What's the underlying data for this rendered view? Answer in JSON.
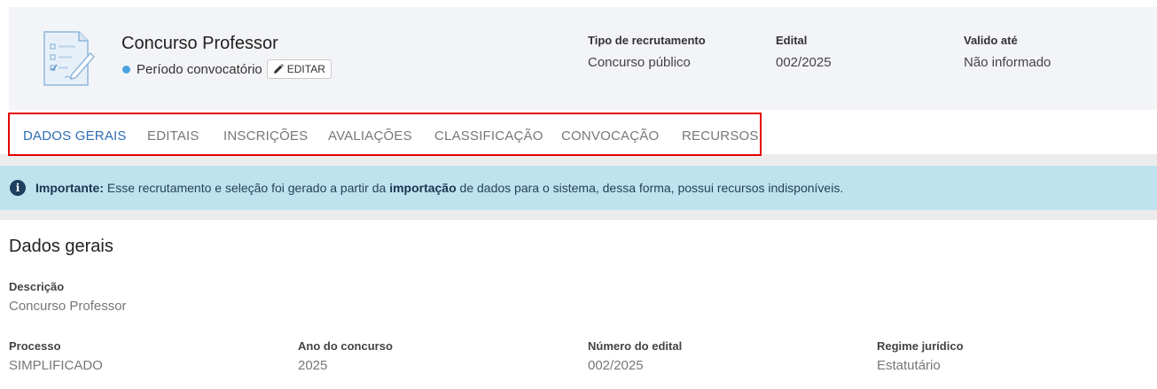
{
  "header": {
    "title": "Concurso Professor",
    "status": "Período convocatório",
    "edit_label": "EDITAR",
    "meta": [
      {
        "label": "Tipo de recrutamento",
        "value": "Concurso público"
      },
      {
        "label": "Edital",
        "value": "002/2025"
      },
      {
        "label": "Valido até",
        "value": "Não informado"
      }
    ]
  },
  "tabs": [
    {
      "label": "DADOS GERAIS",
      "active": true
    },
    {
      "label": "EDITAIS",
      "active": false
    },
    {
      "label": "INSCRIÇÕES",
      "active": false
    },
    {
      "label": "AVALIAÇÕES",
      "active": false
    },
    {
      "label": "CLASSIFICAÇÃO",
      "active": false
    },
    {
      "label": "CONVOCAÇÃO",
      "active": false
    },
    {
      "label": "RECURSOS",
      "active": false
    }
  ],
  "alert": {
    "icon": "info-icon",
    "strong_prefix": "Importante:",
    "text_before": " Esse recrutamento e seleção foi gerado a partir da ",
    "strong_word": "importação",
    "text_after": " de dados para o sistema, dessa forma, possui recursos indisponíveis."
  },
  "section": {
    "title": "Dados gerais",
    "descricao": {
      "label": "Descrição",
      "value": "Concurso Professor"
    },
    "fields": [
      {
        "label": "Processo",
        "value": "SIMPLIFICADO"
      },
      {
        "label": "Ano do concurso",
        "value": "2025"
      },
      {
        "label": "Número do edital",
        "value": "002/2025"
      },
      {
        "label": "Regime jurídico",
        "value": "Estatutário"
      }
    ]
  },
  "colors": {
    "active_tab": "#2d6db3",
    "status_dot": "#4aa3df",
    "alert_bg": "#bfe3ee",
    "highlight_border": "#e30000"
  }
}
